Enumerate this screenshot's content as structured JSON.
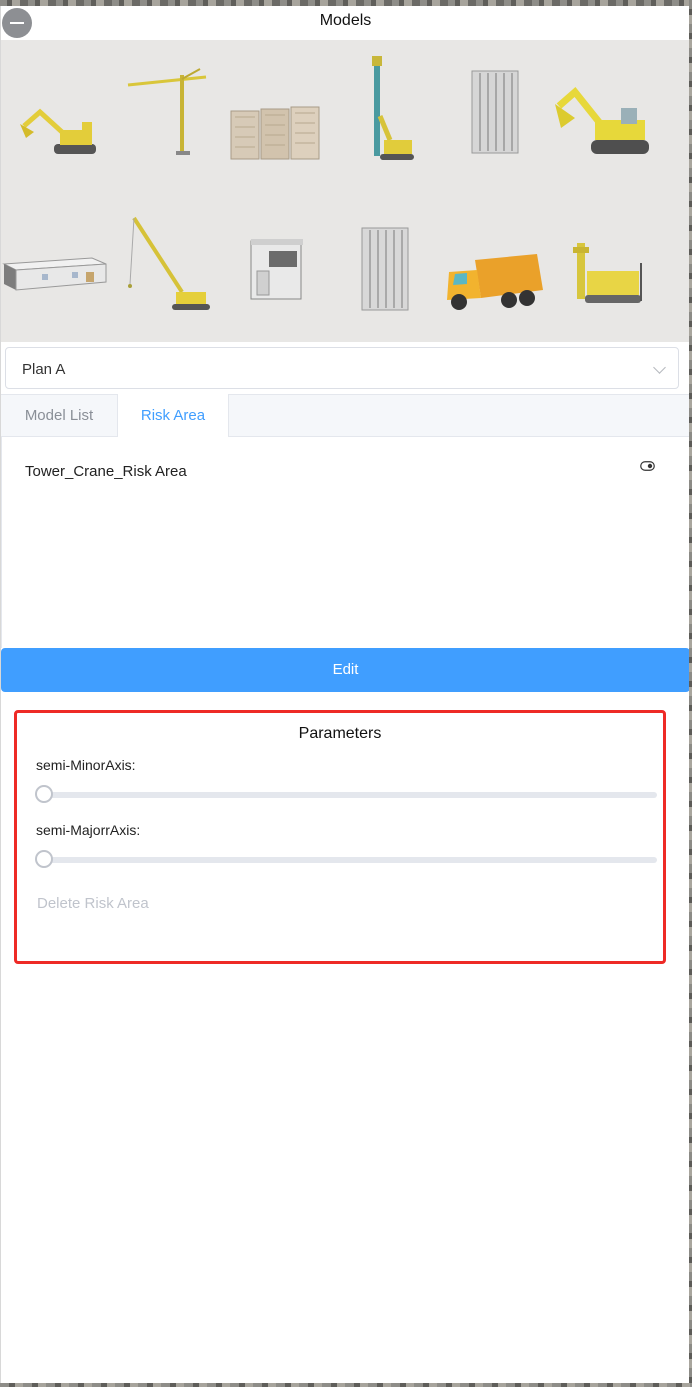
{
  "header": {
    "title": "Models"
  },
  "gallery": {
    "items": [
      {
        "icon": "excavator-small-icon"
      },
      {
        "icon": "tower-crane-icon"
      },
      {
        "icon": "formwork-panels-icon"
      },
      {
        "icon": "pile-driver-icon"
      },
      {
        "icon": "steel-formwork-icon"
      },
      {
        "icon": "excavator-large-icon"
      },
      {
        "icon": "site-office-container-icon"
      },
      {
        "icon": "crawler-crane-icon"
      },
      {
        "icon": "guard-booth-icon"
      },
      {
        "icon": "formwork-panel-icon"
      },
      {
        "icon": "garbage-truck-icon"
      },
      {
        "icon": "drilling-rig-icon"
      }
    ]
  },
  "plan_select": {
    "value": "Plan A"
  },
  "tabs": [
    {
      "label": "Model List",
      "active": false
    },
    {
      "label": "Risk Area",
      "active": true
    }
  ],
  "risk_areas": [
    {
      "label": "Tower_Crane_Risk Area"
    }
  ],
  "edit_button": {
    "label": "Edit"
  },
  "parameters": {
    "title": "Parameters",
    "semi_minor": {
      "label": "semi-MinorAxis:",
      "value": 0
    },
    "semi_major": {
      "label": "semi-MajorrAxis:",
      "value": 0
    },
    "delete_label": "Delete Risk Area"
  },
  "colors": {
    "accent": "#409eff",
    "highlight_border": "#ee2a26",
    "equipment_yellow": "#e5cf3a"
  }
}
